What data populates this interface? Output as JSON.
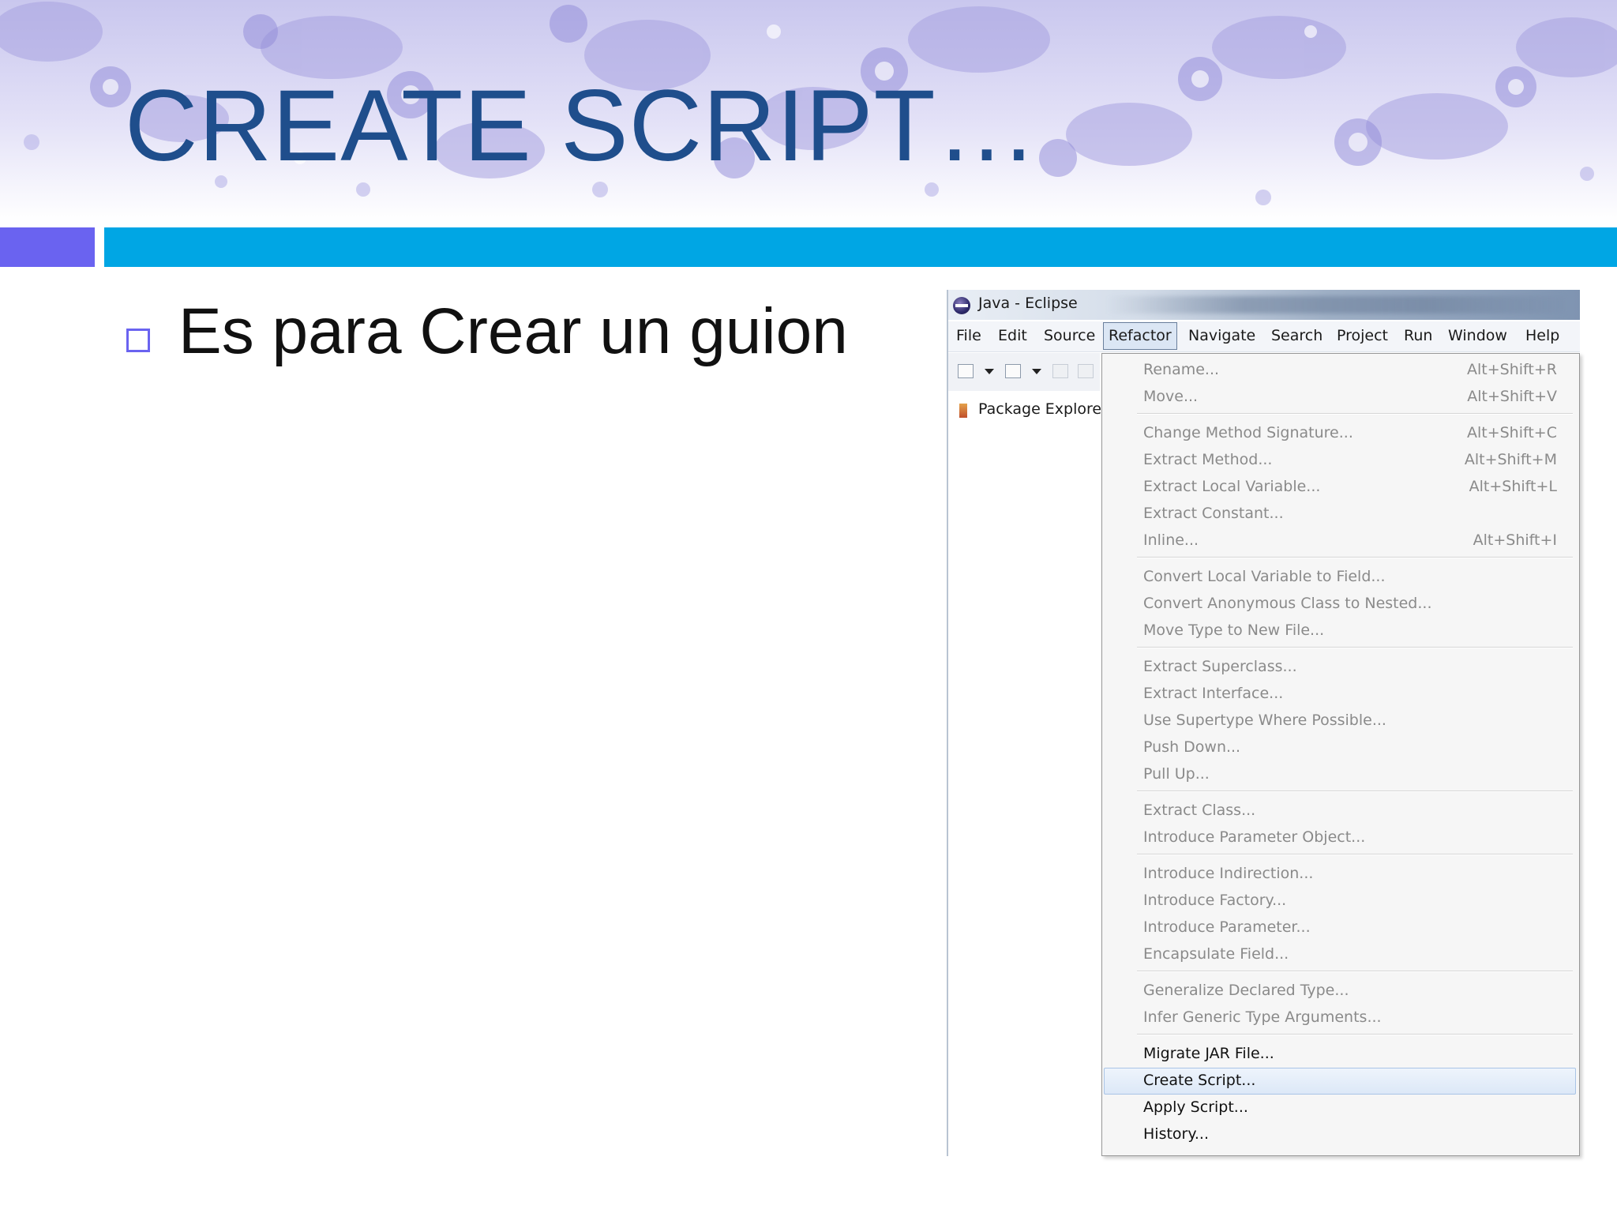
{
  "slide": {
    "title": "CREATE SCRIPT…",
    "bullet": "Es para Crear un guion",
    "colors": {
      "title": "#1f4e8c",
      "accent_block": "#6a63f0",
      "accent_bar": "#00a6e4",
      "bullet_box": "#6a63f0"
    }
  },
  "eclipse": {
    "window_title": "Java - Eclipse",
    "menubar": [
      "File",
      "Edit",
      "Source",
      "Refactor",
      "Navigate",
      "Search",
      "Project",
      "Run",
      "Window",
      "Help"
    ],
    "active_menu": "Refactor",
    "view_tab": "Package Explore",
    "refactor_menu": [
      {
        "label": "Rename...",
        "shortcut": "Alt+Shift+R",
        "enabled": false
      },
      {
        "label": "Move...",
        "shortcut": "Alt+Shift+V",
        "enabled": false
      },
      {
        "label": "Change Method Signature...",
        "shortcut": "Alt+Shift+C",
        "enabled": false
      },
      {
        "label": "Extract Method...",
        "shortcut": "Alt+Shift+M",
        "enabled": false
      },
      {
        "label": "Extract Local Variable...",
        "shortcut": "Alt+Shift+L",
        "enabled": false
      },
      {
        "label": "Extract Constant...",
        "shortcut": "",
        "enabled": false
      },
      {
        "label": "Inline...",
        "shortcut": "Alt+Shift+I",
        "enabled": false
      },
      {
        "label": "Convert Local Variable to Field...",
        "shortcut": "",
        "enabled": false
      },
      {
        "label": "Convert Anonymous Class to Nested...",
        "shortcut": "",
        "enabled": false
      },
      {
        "label": "Move Type to New File...",
        "shortcut": "",
        "enabled": false
      },
      {
        "label": "Extract Superclass...",
        "shortcut": "",
        "enabled": false
      },
      {
        "label": "Extract Interface...",
        "shortcut": "",
        "enabled": false
      },
      {
        "label": "Use Supertype Where Possible...",
        "shortcut": "",
        "enabled": false
      },
      {
        "label": "Push Down...",
        "shortcut": "",
        "enabled": false
      },
      {
        "label": "Pull Up...",
        "shortcut": "",
        "enabled": false
      },
      {
        "label": "Extract Class...",
        "shortcut": "",
        "enabled": false
      },
      {
        "label": "Introduce Parameter Object...",
        "shortcut": "",
        "enabled": false
      },
      {
        "label": "Introduce Indirection...",
        "shortcut": "",
        "enabled": false
      },
      {
        "label": "Introduce Factory...",
        "shortcut": "",
        "enabled": false
      },
      {
        "label": "Introduce Parameter...",
        "shortcut": "",
        "enabled": false
      },
      {
        "label": "Encapsulate Field...",
        "shortcut": "",
        "enabled": false
      },
      {
        "label": "Generalize Declared Type...",
        "shortcut": "",
        "enabled": false
      },
      {
        "label": "Infer Generic Type Arguments...",
        "shortcut": "",
        "enabled": false
      },
      {
        "label": "Migrate JAR File...",
        "shortcut": "",
        "enabled": true
      },
      {
        "label": "Create Script...",
        "shortcut": "",
        "enabled": true,
        "highlighted": true
      },
      {
        "label": "Apply Script...",
        "shortcut": "",
        "enabled": true
      },
      {
        "label": "History...",
        "shortcut": "",
        "enabled": true
      }
    ]
  }
}
